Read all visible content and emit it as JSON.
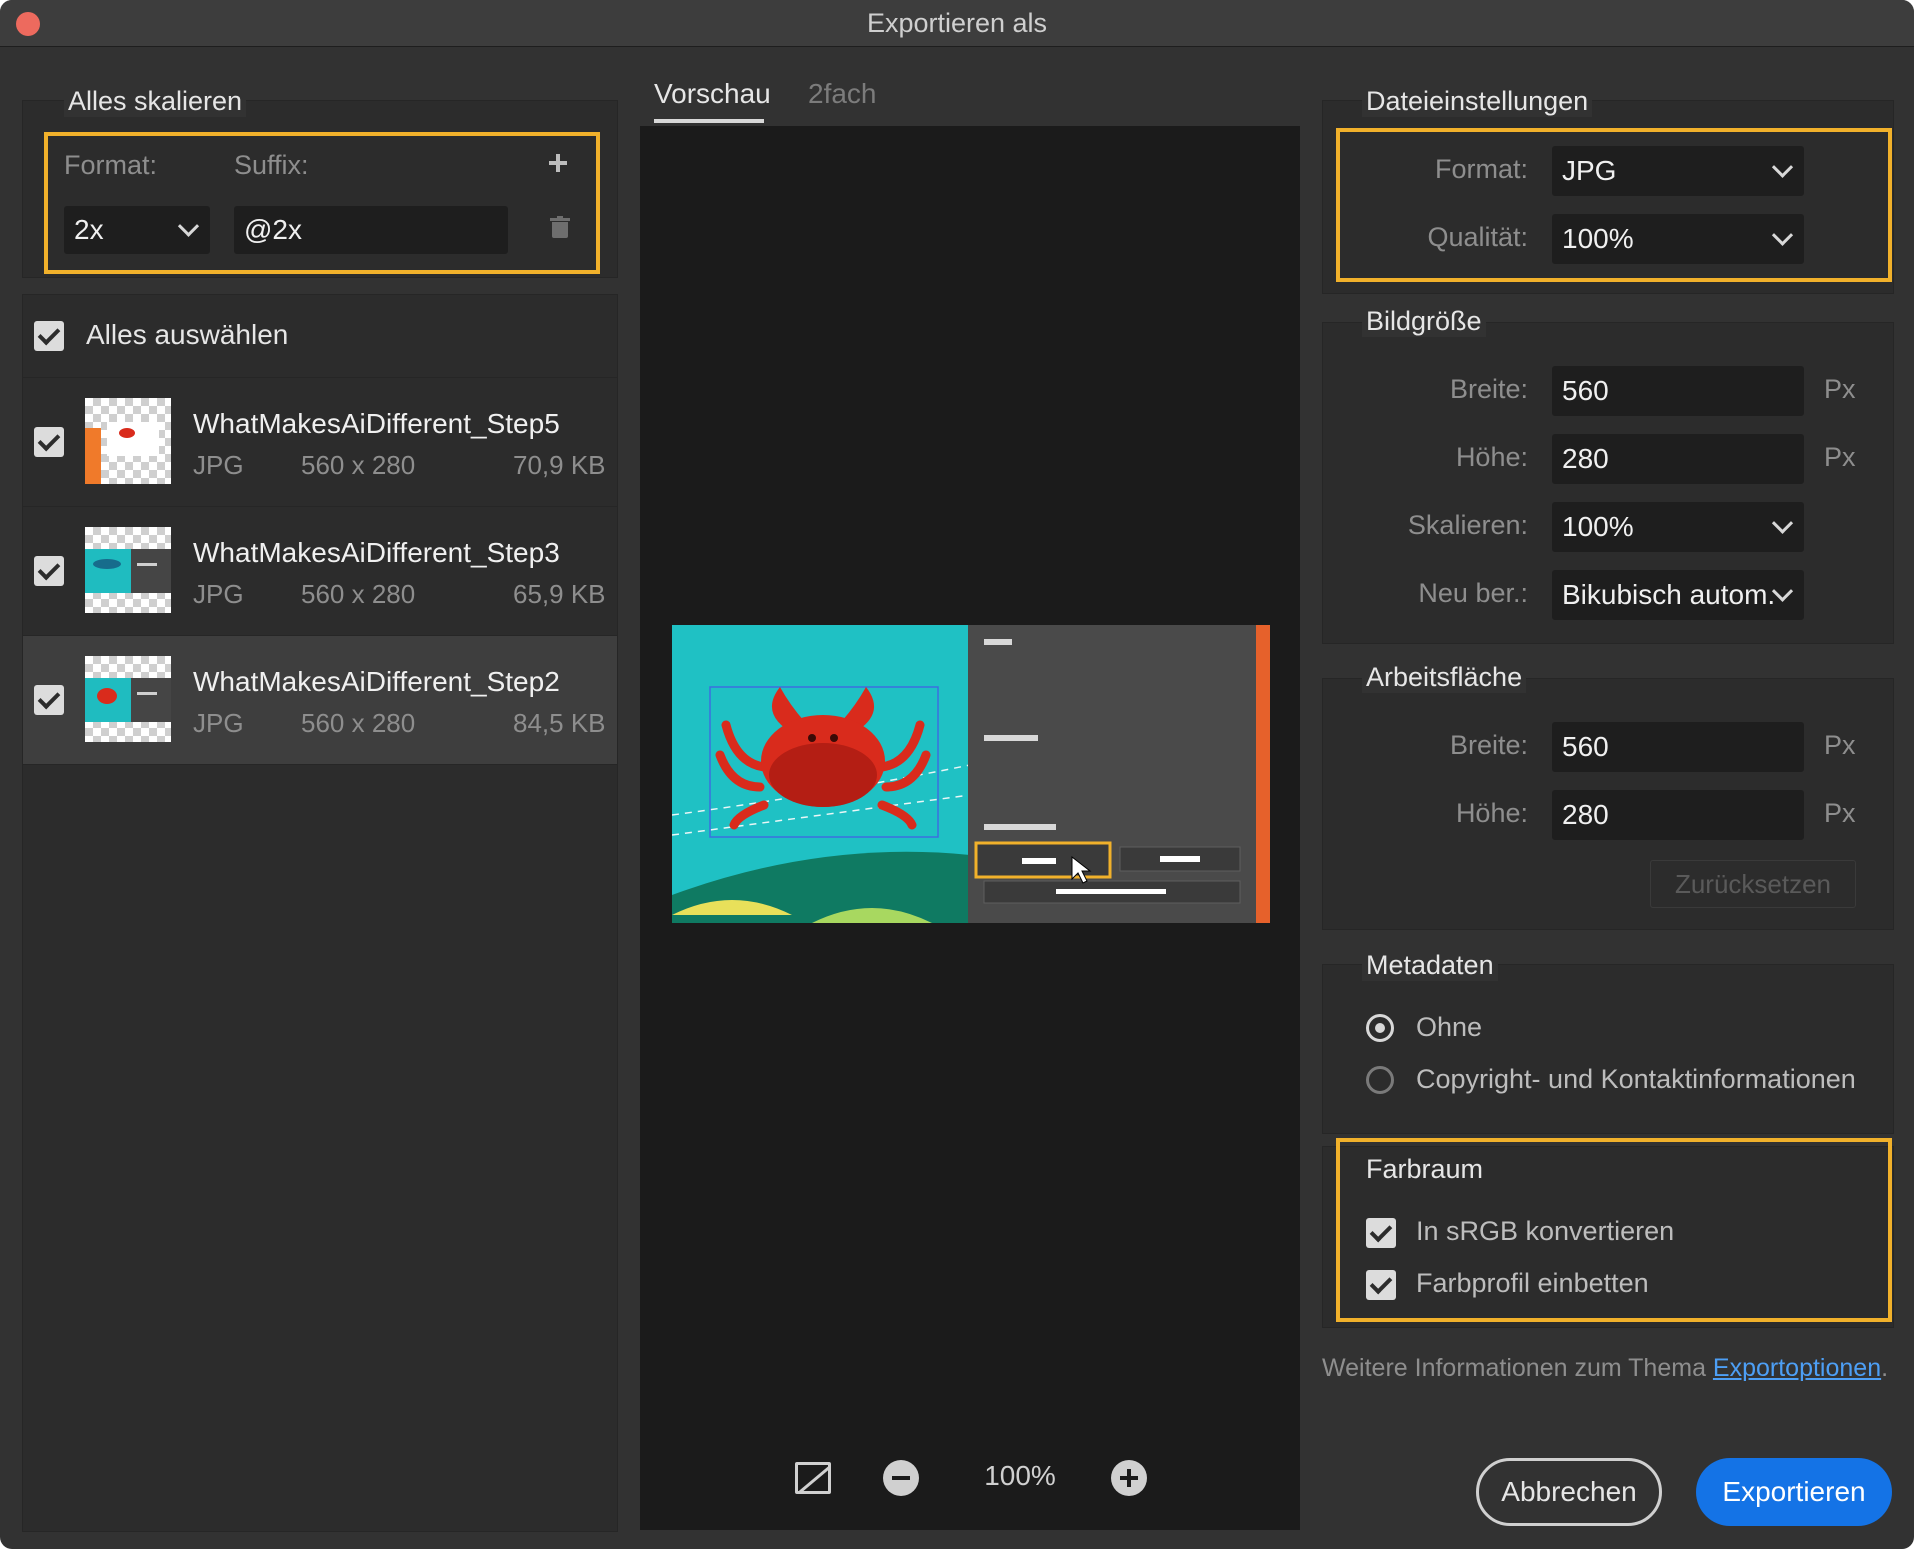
{
  "window": {
    "title": "Exportieren als"
  },
  "left": {
    "scale_section": {
      "title": "Alles skalieren",
      "format_label": "Format:",
      "suffix_label": "Suffix:",
      "format_value": "2x",
      "suffix_value": "@2x",
      "add_icon": "plus-icon",
      "delete_icon": "trash-icon"
    },
    "select_all_label": "Alles auswählen",
    "assets": [
      {
        "name": "WhatMakesAiDifferent_Step5",
        "type": "JPG",
        "dimensions": "560 x 280",
        "size": "70,9 KB",
        "checked": true
      },
      {
        "name": "WhatMakesAiDifferent_Step3",
        "type": "JPG",
        "dimensions": "560 x 280",
        "size": "65,9 KB",
        "checked": true
      },
      {
        "name": "WhatMakesAiDifferent_Step2",
        "type": "JPG",
        "dimensions": "560 x 280",
        "size": "84,5 KB",
        "checked": true,
        "selected": true
      }
    ]
  },
  "center": {
    "tabs": [
      {
        "label": "Vorschau",
        "active": true
      },
      {
        "label": "2fach",
        "active": false
      }
    ],
    "zoom": "100%"
  },
  "right": {
    "file_settings": {
      "title": "Dateieinstellungen",
      "format_label": "Format:",
      "format_value": "JPG",
      "quality_label": "Qualität:",
      "quality_value": "100%"
    },
    "image_size": {
      "title": "Bildgröße",
      "width_label": "Breite:",
      "width_value": "560",
      "height_label": "Höhe:",
      "height_value": "280",
      "scale_label": "Skalieren:",
      "scale_value": "100%",
      "resample_label": "Neu ber.:",
      "resample_value": "Bikubisch autom.",
      "unit": "Px"
    },
    "artboard": {
      "title": "Arbeitsfläche",
      "width_label": "Breite:",
      "width_value": "560",
      "height_label": "Höhe:",
      "height_value": "280",
      "unit": "Px",
      "reset_label": "Zurücksetzen"
    },
    "metadata": {
      "title": "Metadaten",
      "option_none": "Ohne",
      "option_copyright": "Copyright- und Kontaktinformationen",
      "selected": "Ohne"
    },
    "colorspace": {
      "title": "Farbraum",
      "srgb_label": "In sRGB konvertieren",
      "embed_label": "Farbprofil einbetten"
    },
    "info_text": "Weitere Informationen zum Thema ",
    "info_link": "Exportoptionen",
    "info_end": "."
  },
  "buttons": {
    "cancel": "Abbrechen",
    "export": "Exportieren"
  },
  "colors": {
    "highlight": "#f1b12b",
    "accent": "#1473e6",
    "link": "#4d9ff5"
  }
}
